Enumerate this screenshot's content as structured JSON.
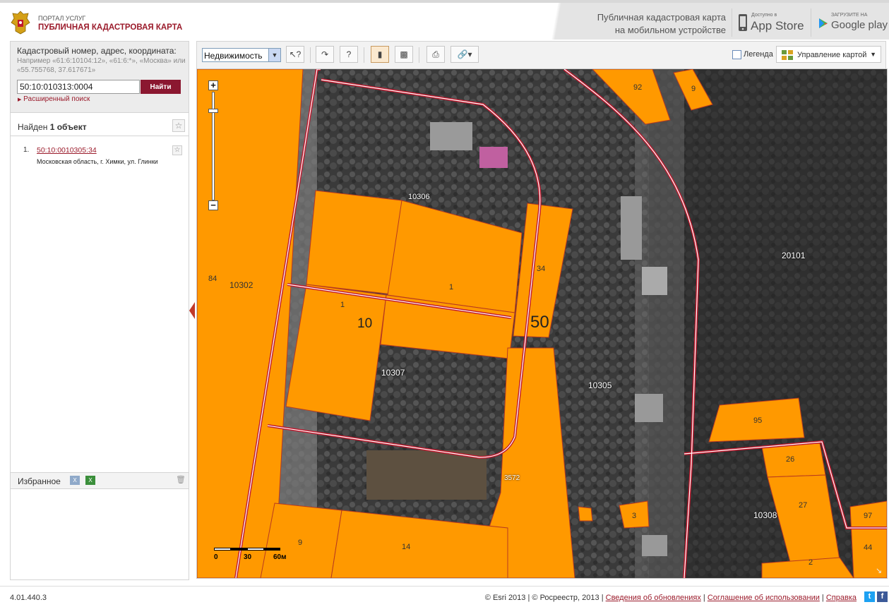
{
  "header": {
    "portal": "ПОРТАЛ УСЛУГ",
    "title": "ПУБЛИЧНАЯ КАДАСТРОВАЯ КАРТА",
    "mobile_line1": "Публичная кадастровая карта",
    "mobile_line2": "на мобильном устройстве",
    "appstore_small": "Доступно в",
    "appstore_big": "App Store",
    "googleplay_small": "ЗАГРУЗИТЕ НА",
    "googleplay_big": "Google play"
  },
  "search": {
    "label": "Кадастровый номер, адрес, координата:",
    "example": "Например «61:6:10104:12», «61:6:*», «Москва» или «55.755768, 37.617671»",
    "value": "50:10:010313:0004",
    "button": "Найти",
    "advanced": "Расширенный поиск"
  },
  "results": {
    "found_prefix": "Найден ",
    "found_count": "1 объект",
    "items": [
      {
        "num": "1.",
        "cadastral": "50:10:0010305:34",
        "address": "Московская область, г. Химки, ул. Глинки"
      }
    ]
  },
  "favorites": {
    "label": "Избранное"
  },
  "toolbar": {
    "layer": "Недвижимость",
    "legend": "Легенда",
    "map_control": "Управление картой"
  },
  "map": {
    "labels": [
      "92",
      "9",
      "10306",
      "34",
      "1",
      "1",
      "10",
      "50",
      "84",
      "10302",
      "20101",
      "10307",
      "10305",
      "95",
      "26",
      "27",
      "10308",
      "97",
      "44",
      "2",
      "3",
      "3572",
      "9",
      "14"
    ],
    "scale": {
      "l0": "0",
      "l1": "30",
      "l2": "60м"
    },
    "colors": {
      "parcel": "#ff9900",
      "boundary": "#c0182d"
    }
  },
  "footer": {
    "version": "4.01.440.3",
    "esri": "© Esri 2013",
    "rosreestr": "© Росреестр, 2013",
    "link_updates": "Сведения об обновлениях",
    "link_agreement": "Соглашение об использовании",
    "link_help": "Справка"
  }
}
